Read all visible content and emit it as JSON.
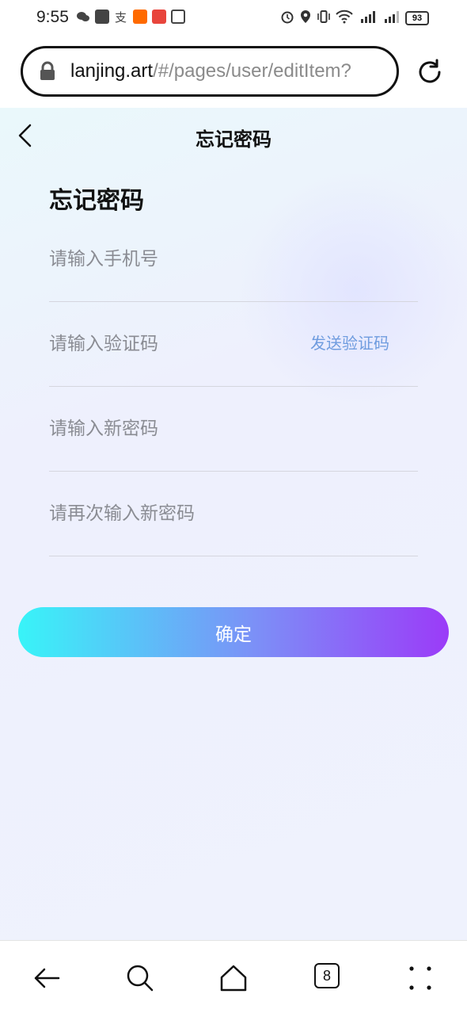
{
  "status_bar": {
    "time": "9:55",
    "battery": "93",
    "left_icons": [
      "wechat-icon",
      "message-icon",
      "alipay-icon",
      "taobao-icon",
      "app-icon",
      "nfc-icon"
    ],
    "right_icons": [
      "alarm-icon",
      "location-icon",
      "vibrate-icon",
      "wifi-icon",
      "signal-4g-icon",
      "signal-4g-icon"
    ]
  },
  "browser": {
    "url_host": "lanjing.art",
    "url_path": "/#/pages/user/editItem?"
  },
  "header": {
    "title": "忘记密码"
  },
  "form": {
    "heading": "忘记密码",
    "phone_placeholder": "请输入手机号",
    "code_placeholder": "请输入验证码",
    "send_code_label": "发送验证码",
    "new_password_placeholder": "请输入新密码",
    "confirm_password_placeholder": "请再次输入新密码",
    "submit_label": "确定"
  },
  "bottom_nav": {
    "tab_count": "8"
  },
  "colors": {
    "accent_link": "#6f9cdf",
    "button_gradient_start": "#38f4f8",
    "button_gradient_end": "#9b3bf8"
  }
}
